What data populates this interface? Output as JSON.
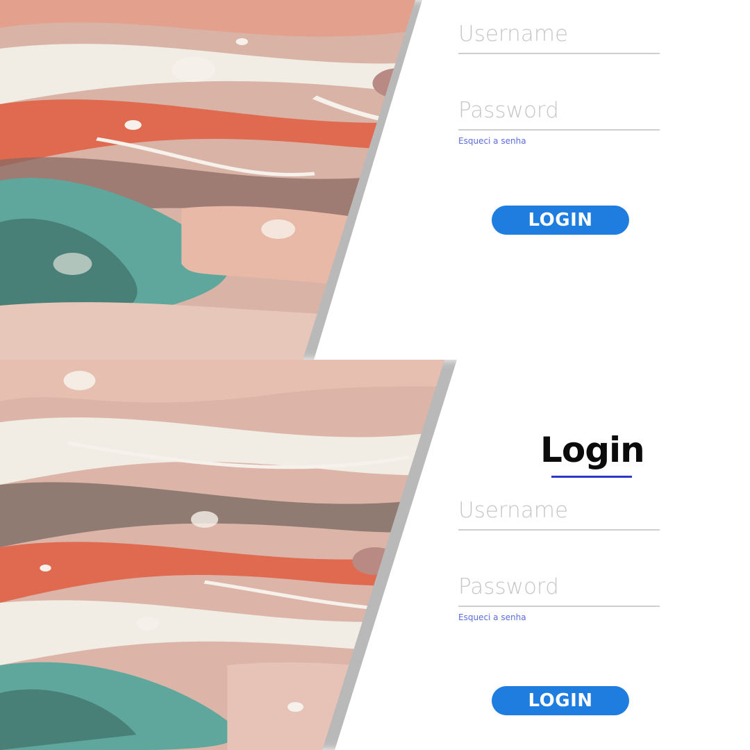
{
  "screens": [
    {
      "username_placeholder": "Username",
      "password_placeholder": "Password",
      "forgot_label": "Esqueci a senha",
      "login_button_label": "LOGIN"
    },
    {
      "title": "Login",
      "username_placeholder": "Username",
      "password_placeholder": "Password",
      "forgot_label": "Esqueci a senha",
      "login_button_label": "LOGIN"
    }
  ],
  "colors": {
    "button": "#1f7de0",
    "link": "#5a6be0",
    "title_underline": "#2e38c8",
    "input_line": "#cfcfcf",
    "art_base": "#d9b3a6",
    "art_coral": "#e06a50",
    "art_teal": "#5fa79c",
    "art_brown": "#8a6a62",
    "art_cream": "#f1ece4"
  }
}
